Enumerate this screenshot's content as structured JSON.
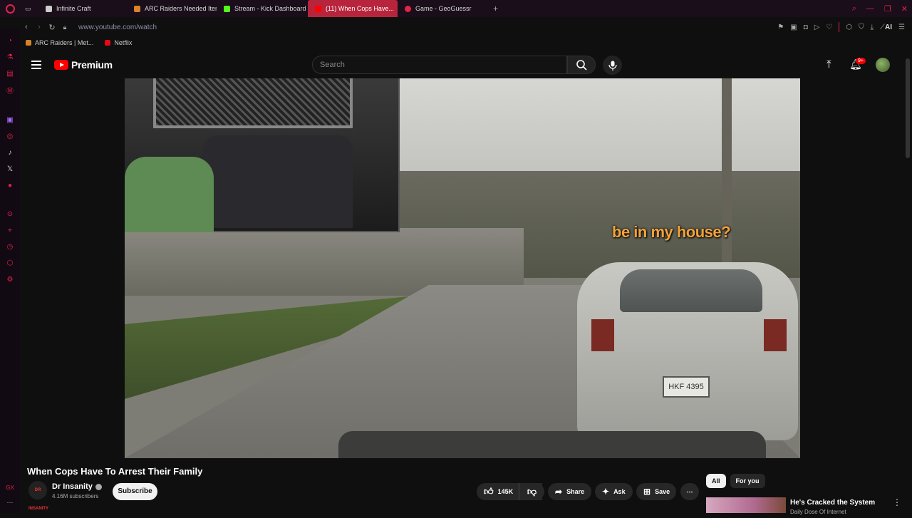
{
  "browser": {
    "tabs": [
      {
        "label": "Infinite Craft",
        "color": "#cccccc"
      },
      {
        "label": "ARC Raiders Needed Item...",
        "color": "#d9822b"
      },
      {
        "label": "Stream - Kick Dashboard",
        "color": "#53fc18"
      },
      {
        "label": "(11) When Cops Have...",
        "color": "#ff0000"
      },
      {
        "label": "Game - GeoGuessr",
        "color": "#e0244a"
      }
    ],
    "new_tab": "+",
    "url": "www.youtube.com/watch",
    "bookmarks": [
      {
        "label": "ARC Raiders | Met...",
        "color": "#d9822b"
      },
      {
        "label": "Netflix",
        "color": "#e50914"
      }
    ],
    "ai_label": "AI",
    "sidebar_bottom": "GX",
    "accent": "#e0244a"
  },
  "youtube": {
    "brand": "Premium",
    "search_placeholder": "Search",
    "notif_badge": "9+",
    "caption": "be in my house?",
    "plate": "HKF 4395",
    "video_title": "When Cops Have To Arrest Their Family",
    "channel": {
      "name": "Dr Insanity",
      "subscribers": "4.16M subscribers",
      "avatar_text": "DR INSANITY"
    },
    "subscribe_label": "Subscribe",
    "actions": {
      "likes": "145K",
      "share": "Share",
      "ask": "Ask",
      "save": "Save",
      "more": "⋯"
    },
    "chips": [
      "All",
      "For you"
    ],
    "recommended": {
      "title": "He's Cracked the System",
      "channel": "Daily Dose Of Internet"
    }
  }
}
